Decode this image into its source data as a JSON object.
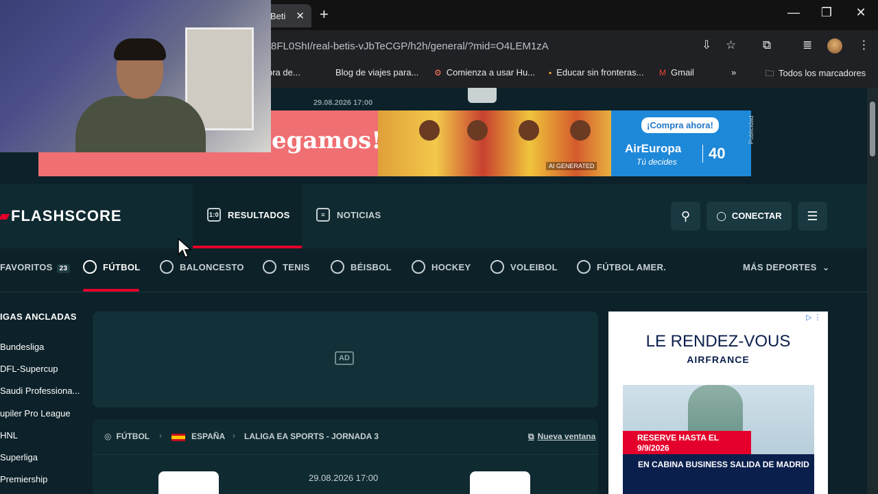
{
  "browser": {
    "tab_title": "Beti",
    "url": "8FL0ShI/real-betis-vJbTeCGP/h2h/general/?mid=O4LEM1zA",
    "bookmarks": [
      {
        "label": "pra de...",
        "icon": ""
      },
      {
        "label": "Blog de viajes para...",
        "icon": ""
      },
      {
        "label": "Comienza a usar Hu...",
        "icon": "hubspot-icon"
      },
      {
        "label": "Educar sin fronteras...",
        "icon": "bookmark-icon"
      },
      {
        "label": "Gmail",
        "icon": "gmail-icon"
      }
    ],
    "all_bookmarks": "Todos los marcadores"
  },
  "page": {
    "top_date": "29.08.2026 17:00",
    "banner": {
      "headline": "egamos!",
      "ai_label": "AI GENERATED",
      "cta": "¡Compra ahora!",
      "brand": "AirEuropa",
      "tagline": "Tú decides",
      "anniversary": "40",
      "publicidad": "Publicidad"
    },
    "header": {
      "logo": "FLASHSCORE",
      "nav": [
        {
          "label": "RESULTADOS",
          "active": true
        },
        {
          "label": "NOTICIAS",
          "active": false
        }
      ],
      "connect": "CONECTAR"
    },
    "sports": {
      "items": [
        {
          "label": "FAVORITOS",
          "badge": "23"
        },
        {
          "label": "FÚTBOL",
          "active": true
        },
        {
          "label": "BALONCESTO"
        },
        {
          "label": "TENIS"
        },
        {
          "label": "BÉISBOL"
        },
        {
          "label": "HOCKEY"
        },
        {
          "label": "VOLEIBOL"
        },
        {
          "label": "FÚTBOL AMER."
        }
      ],
      "more": "MÁS DEPORTES"
    },
    "sidebar": {
      "title": "IGAS ANCLADAS",
      "items": [
        "Bundesliga",
        "DFL-Supercup",
        "Saudi Professiona...",
        "upiler Pro League",
        "HNL",
        "Superliga",
        "Premiership"
      ]
    },
    "ad_label": "AD",
    "match": {
      "breadcrumb": [
        "FÚTBOL",
        "ESPAÑA",
        "LALIGA EA SPORTS - JORNADA 3"
      ],
      "new_window": "Nueva ventana",
      "datetime": "29.08.2026 17:00"
    },
    "side_ad": {
      "headline": "LE RENDEZ-VOUS",
      "brand": "AIRFRANCE",
      "reserve": "RESERVE HASTA EL 9/9/2026",
      "cabin": "EN CABINA BUSINESS SALIDA DE MADRID"
    }
  }
}
